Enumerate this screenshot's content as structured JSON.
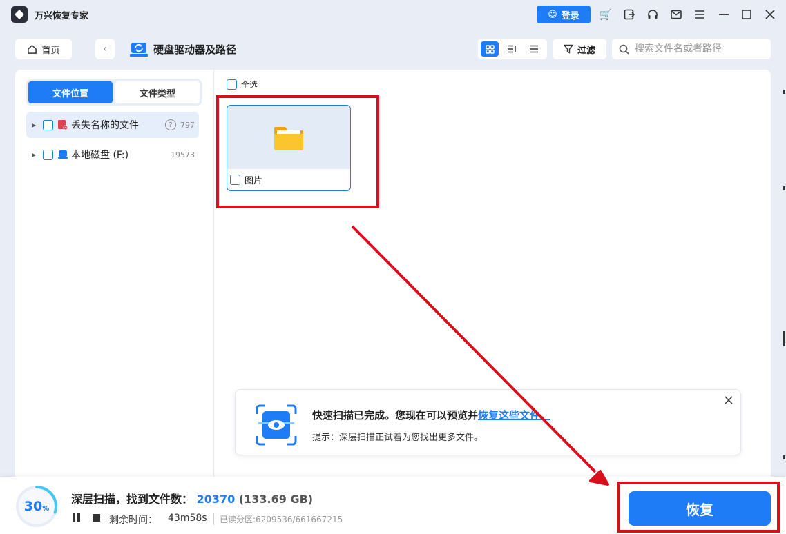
{
  "app": {
    "title": "万兴恢复专家",
    "login_label": "登录"
  },
  "toolbar": {
    "home_label": "首页",
    "path_title": "硬盘驱动器及路径",
    "filter_label": "过滤",
    "search_placeholder": "搜索文件名或者路径"
  },
  "sidebar": {
    "tabs": [
      {
        "label": "文件位置",
        "active": true
      },
      {
        "label": "文件类型",
        "active": false
      }
    ],
    "items": [
      {
        "label": "丢失名称的文件",
        "count": "797"
      },
      {
        "label": "本地磁盘 (F:)",
        "count": "19573"
      }
    ]
  },
  "main": {
    "select_all_label": "全选",
    "folders": [
      {
        "label": "图片"
      }
    ]
  },
  "toast": {
    "title_prefix": "快速扫描已完成。您现在可以预览并",
    "title_link": "恢复这些文件。",
    "tip": "提示：深层扫描正试着为您找出更多文件。"
  },
  "status": {
    "progress": "30",
    "progress_unit": "%",
    "progress_fraction": 0.3,
    "scan_label": "深层扫描，找到文件数：",
    "file_count": "20370",
    "size": "(133.69 GB)",
    "remaining_label": "剩余时间：",
    "remaining_value": "43m58s",
    "partition": "已读分区:6209536/661667215"
  },
  "actions": {
    "recover_label": "恢复"
  },
  "colors": {
    "accent": "#1e7cf6",
    "annotation": "#d7101c",
    "folder": "#f7b21b"
  }
}
